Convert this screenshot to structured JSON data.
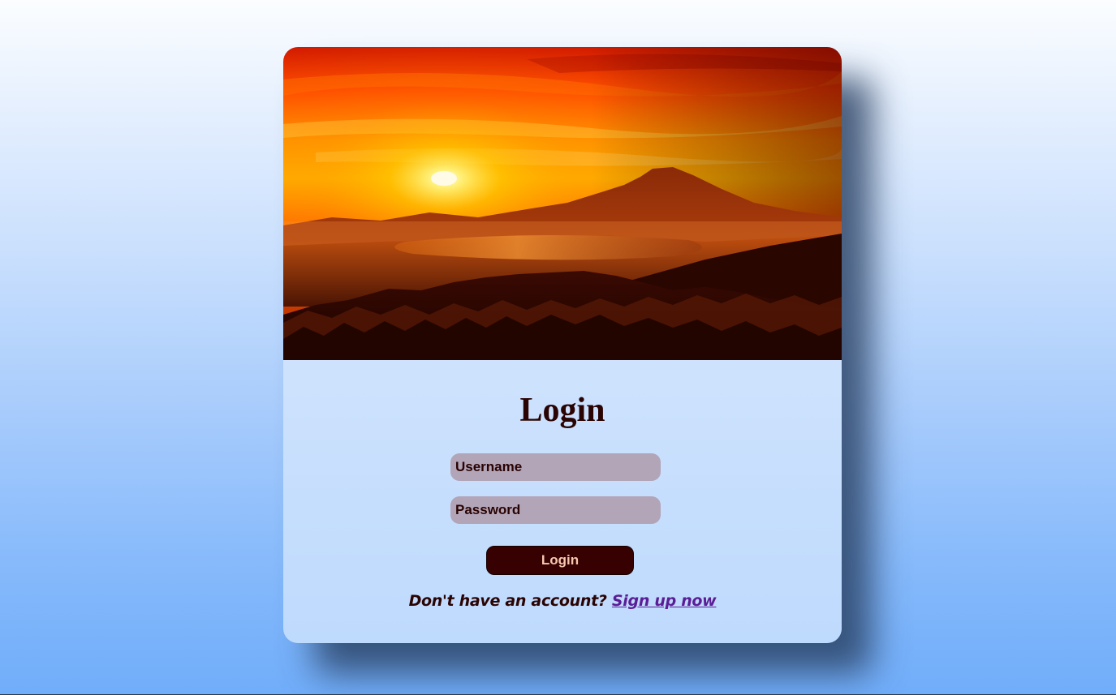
{
  "page": {
    "background_top": "#fbfdff",
    "background_bottom": "#70adfa"
  },
  "login_card": {
    "hero_image": "sunset-over-volcano-mountains",
    "title": "Login",
    "username_placeholder": "Username",
    "password_placeholder": "Password",
    "login_button_label": "Login",
    "signup_prompt": "Don't have an account?",
    "signup_link_label": "Sign up now"
  },
  "colors": {
    "title_text": "#2a0303",
    "input_background": "#b2a5b8",
    "button_background": "#370101",
    "button_text": "#f6c8b0",
    "link": "#5b1d96"
  }
}
